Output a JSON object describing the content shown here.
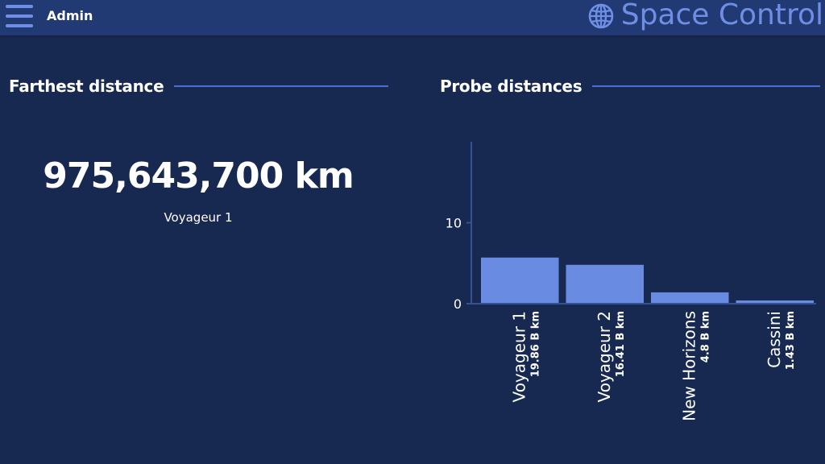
{
  "header": {
    "user_label": "Admin",
    "brand_title": "Space Control",
    "brand_icon": "globe-icon",
    "menu_icon": "hamburger-menu-icon"
  },
  "colors": {
    "background": "#182951",
    "topbar": "#223a73",
    "accent": "#6f8fe6",
    "rule": "#4a6fd1",
    "text": "#ffffff"
  },
  "left_panel": {
    "title": "Farthest distance",
    "value": "975,643,700 km",
    "caption": "Voyageur 1"
  },
  "right_panel": {
    "title": "Probe distances"
  },
  "chart_data": {
    "type": "bar",
    "categories": [
      "Voyageur 1",
      "Voyageur 2",
      "New Horizons",
      "Cassini"
    ],
    "sublabels": [
      "19.86 B km",
      "16.41 B km",
      "4.8 B km",
      "1.43 B km"
    ],
    "values": [
      5.7,
      4.8,
      1.4,
      0.4
    ],
    "yticks": [
      0,
      10
    ],
    "ylim": [
      0,
      20
    ],
    "grid": false,
    "bar_color": "#6a8be2",
    "axis_color": "#35518f"
  }
}
